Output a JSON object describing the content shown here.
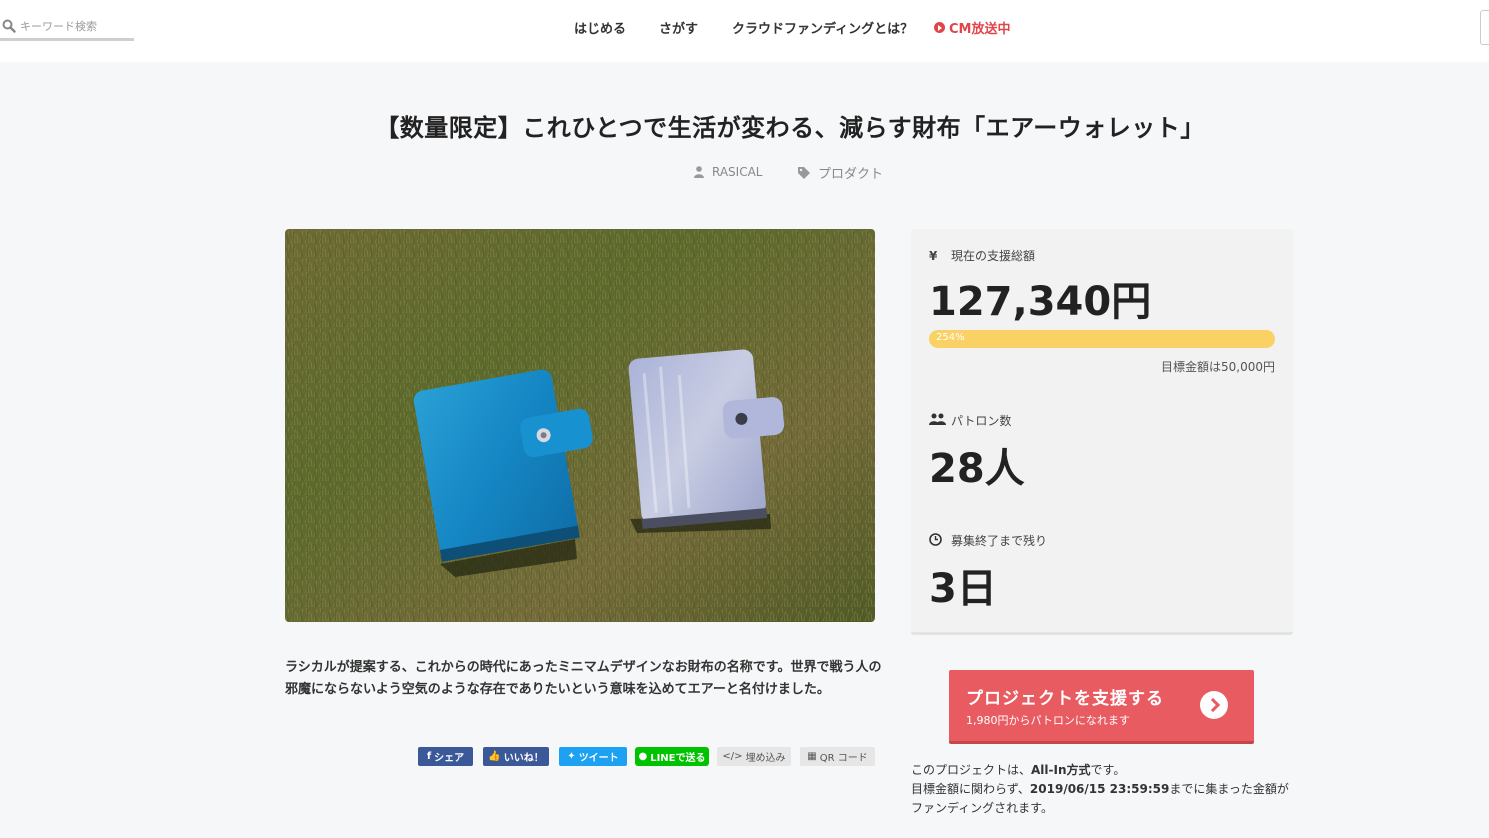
{
  "header": {
    "search_placeholder": "キーワード検索",
    "nav": [
      "はじめる",
      "さがす",
      "クラウドファンディングとは？",
      "CM放送中"
    ]
  },
  "project": {
    "title": "【数量限定】これひとつで生活が変わる、減らす財布「エアーウォレット」",
    "owner": "RASICAL",
    "category": "プロダクト",
    "description": "ラシカルが提案する、これからの時代にあったミニマムデザインなお財布の名称です。世界で戦う人の邪魔にならないよう空気のような存在でありたいという意味を込めてエアーと名付けました。"
  },
  "share": {
    "facebook": "シェア",
    "like": "いいね！",
    "tweet": "ツイート",
    "line": "LINEで送る",
    "embed": "埋め込み",
    "qr": "QR コード"
  },
  "stats": {
    "funded_label": "現在の支援総額",
    "funded_icon": "yen-icon",
    "funded_value": "127,340円",
    "progress_label": "254%",
    "progress_percent": 254,
    "goal_text": "目標金額は50,000円",
    "patrons_label": "パトロン数",
    "patrons_value": "28人",
    "remaining_label": "募集終了まで残り",
    "remaining_value": "3日"
  },
  "support": {
    "button_label": "プロジェクトを支援する",
    "button_sub": "1,980円からパトロンになれます"
  },
  "notes": {
    "line1_pre": "このプロジェクトは、",
    "line1_bold": "All-In方式",
    "line1_post": "です。",
    "line2_pre": "目標金額に関わらず、",
    "line2_bold": "2019/06/15 23:59:59",
    "line2_post": "までに集まった金額が",
    "line3": "ファンディングされます。"
  },
  "colors": {
    "accent": "#e85b61",
    "progress": "#fad165",
    "facebook": "#3b5998",
    "twitter": "#1da1f2",
    "line": "#00c300"
  }
}
